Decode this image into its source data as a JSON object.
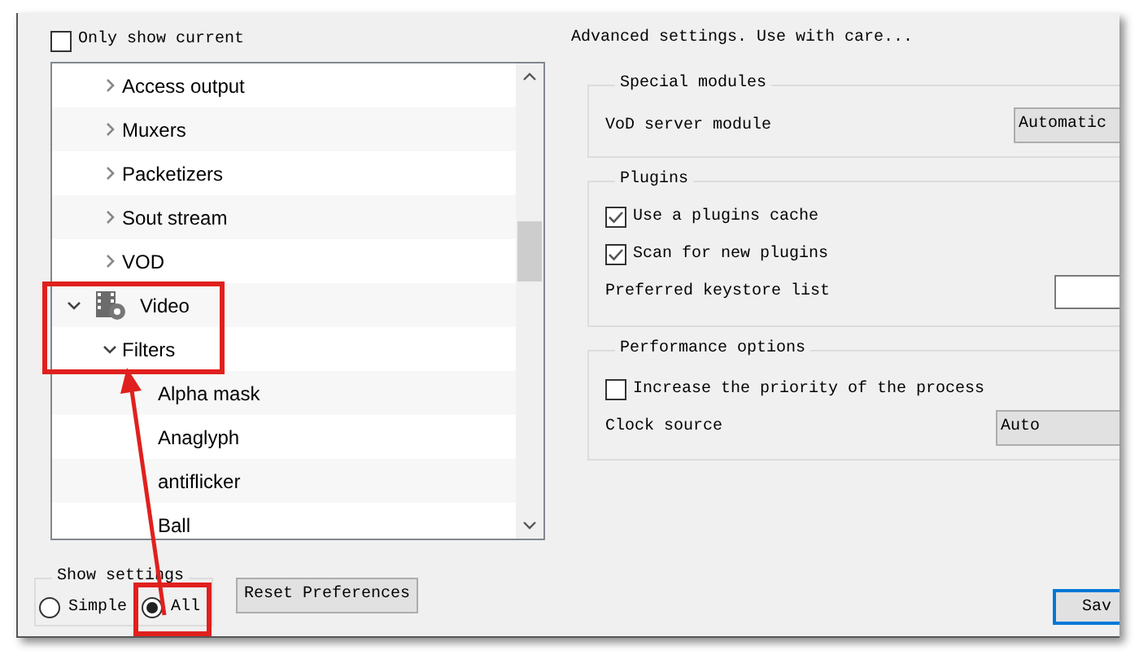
{
  "left": {
    "only_current": {
      "label": "Only show current",
      "checked": false
    },
    "tree": [
      {
        "children": [
          {
            "label": "Access output",
            "expanded": false
          },
          {
            "label": "Muxers",
            "expanded": false
          },
          {
            "label": "Packetizers",
            "expanded": false
          },
          {
            "label": "Sout stream",
            "expanded": false
          },
          {
            "label": "VOD",
            "expanded": false
          }
        ]
      },
      {
        "label": "Video",
        "kind": "category",
        "expanded": true,
        "children": [
          {
            "label": "Filters",
            "expanded": true,
            "children": [
              {
                "label": "Alpha mask"
              },
              {
                "label": "Anaglyph"
              },
              {
                "label": "antiflicker"
              },
              {
                "label": "Ball"
              }
            ]
          }
        ]
      }
    ],
    "show_settings": {
      "title": "Show settings",
      "options": [
        {
          "label": "Simple",
          "selected": false
        },
        {
          "label": "All",
          "selected": true
        }
      ]
    },
    "reset_button": "Reset Preferences"
  },
  "right": {
    "heading": "Advanced settings. Use with care...",
    "groups": [
      {
        "title": "Special modules",
        "rows": [
          {
            "kind": "select",
            "label": "VoD server module",
            "value": "Automatic"
          }
        ]
      },
      {
        "title": "Plugins",
        "rows": [
          {
            "kind": "checkbox",
            "label": "Use a plugins cache",
            "checked": true
          },
          {
            "kind": "checkbox",
            "label": "Scan for new plugins",
            "checked": true
          },
          {
            "kind": "text",
            "label": "Preferred keystore list"
          }
        ]
      },
      {
        "title": "Performance options",
        "rows": [
          {
            "kind": "checkbox",
            "label": "Increase the priority of the process",
            "checked": false
          },
          {
            "kind": "select",
            "label": "Clock source",
            "value": "Auto"
          }
        ]
      }
    ],
    "save_button": "Sav"
  }
}
